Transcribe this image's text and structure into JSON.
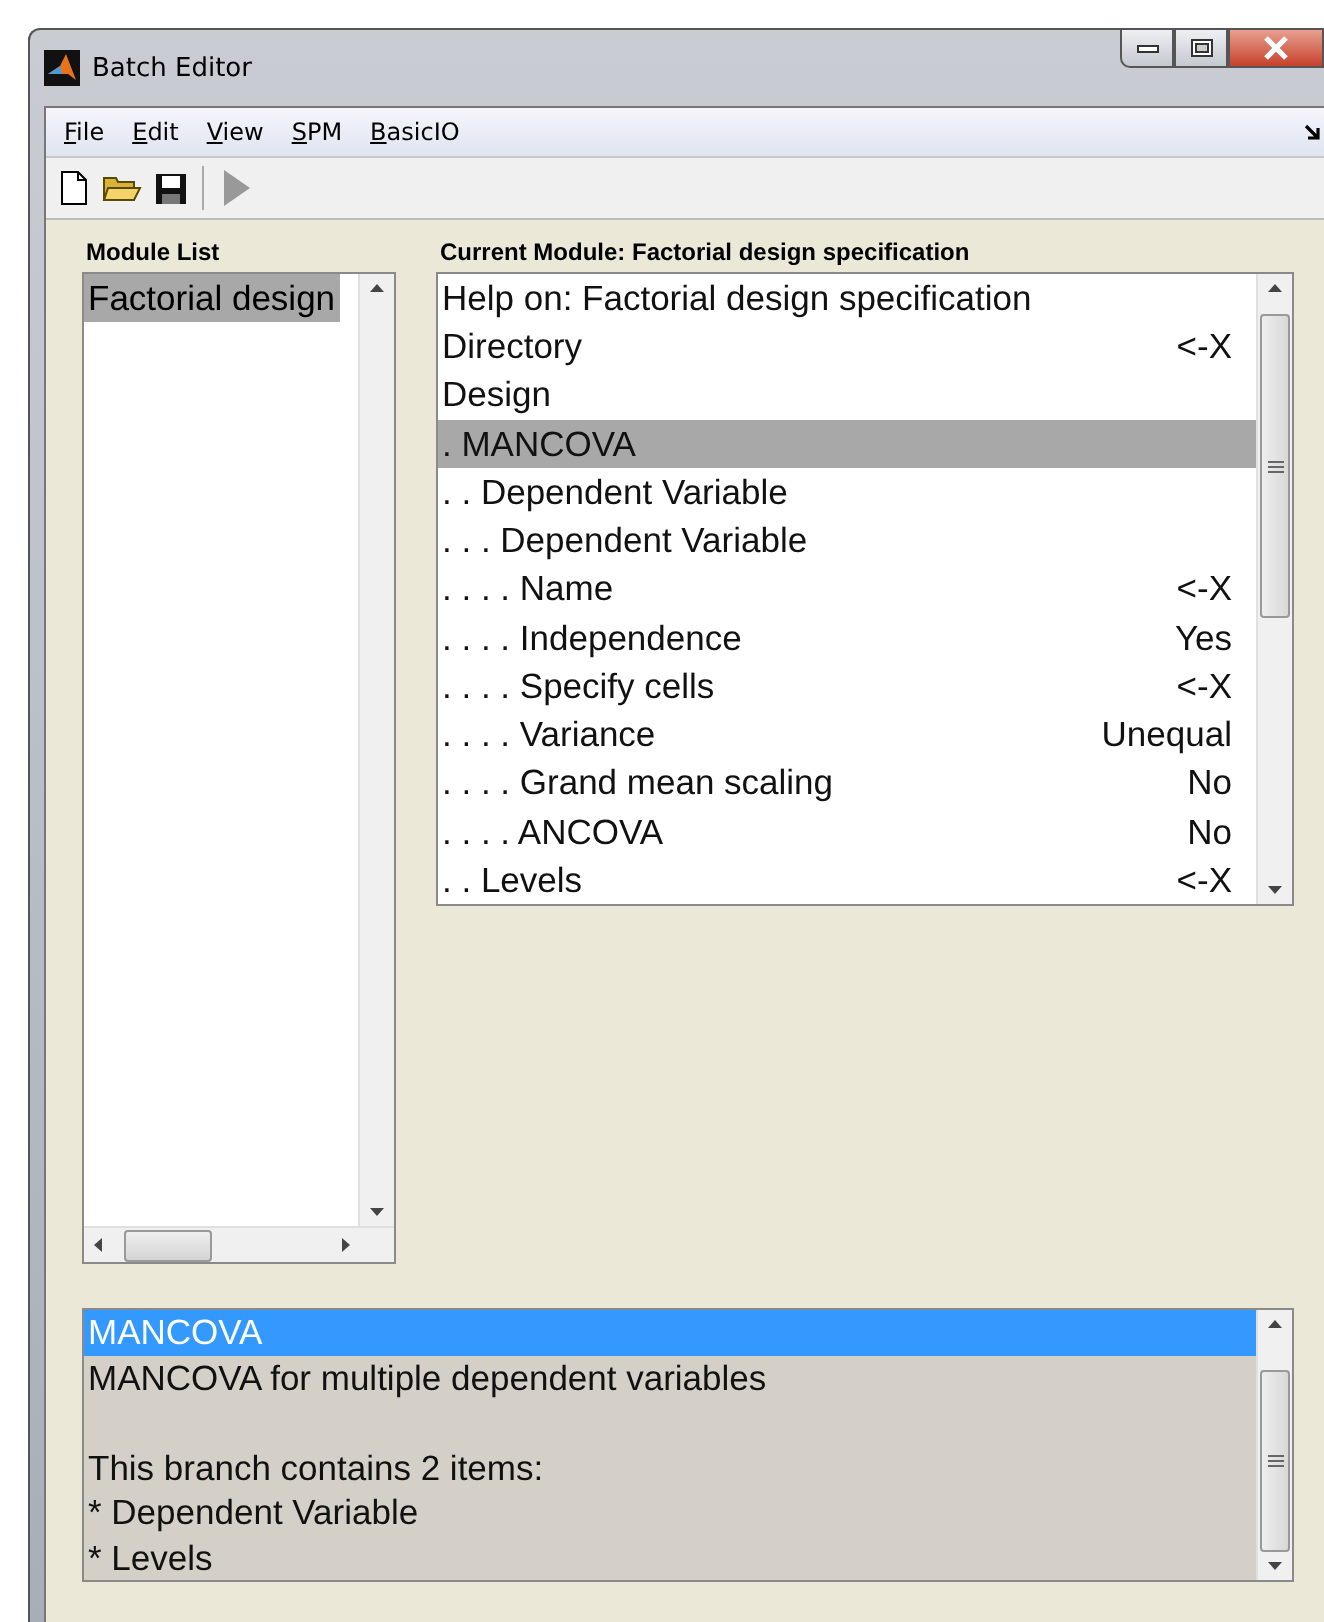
{
  "window": {
    "title": "Batch Editor"
  },
  "menu": [
    "File",
    "Edit",
    "View",
    "SPM",
    "BasicIO"
  ],
  "module_list": {
    "label": "Module List",
    "items": [
      {
        "label": "Factorial design",
        "selected": true
      }
    ]
  },
  "current_module": {
    "label": "Current Module: Factorial design specification",
    "items": [
      {
        "label": "Help on: Factorial design specification",
        "selected": false
      },
      {
        "label": "Directory",
        "value": "<-X",
        "selected": false
      },
      {
        "label": "Design",
        "selected": false,
        "children": [
          {
            "label": ". MANCOVA",
            "selected": true,
            "children": [
              {
                "label": ". . Dependent Variable",
                "selected": false,
                "children": [
                  {
                    "label": ". . . Dependent Variable",
                    "selected": false,
                    "children": [
                      {
                        "label": ". . . . Name",
                        "value": "<-X",
                        "selected": false
                      },
                      {
                        "label": ". . . . Independence",
                        "value": "Yes",
                        "selected": false
                      },
                      {
                        "label": ". . . . Specify cells",
                        "value": "<-X",
                        "selected": false
                      },
                      {
                        "label": ". . . . Variance",
                        "value": "Unequal",
                        "selected": false
                      },
                      {
                        "label": ". . . . Grand mean scaling",
                        "value": "No",
                        "selected": false
                      },
                      {
                        "label": ". . . . ANCOVA",
                        "value": "No",
                        "selected": false
                      }
                    ]
                  }
                ]
              },
              {
                "label": ". . Levels",
                "value": "<-X",
                "selected": false
              }
            ]
          }
        ]
      }
    ]
  },
  "help": {
    "lines": [
      {
        "kind": "text",
        "text": "MANCOVA",
        "selected": true
      },
      {
        "kind": "text",
        "text": "MANCOVA for multiple dependent variables",
        "selected": false
      },
      {
        "kind": "blank",
        "selected": false
      },
      {
        "kind": "text",
        "text": "This branch contains 2 items:",
        "selected": false
      },
      {
        "kind": "text",
        "text": "* Dependent Variable",
        "selected": false
      },
      {
        "kind": "text",
        "text": "* Levels",
        "selected": false
      }
    ]
  }
}
